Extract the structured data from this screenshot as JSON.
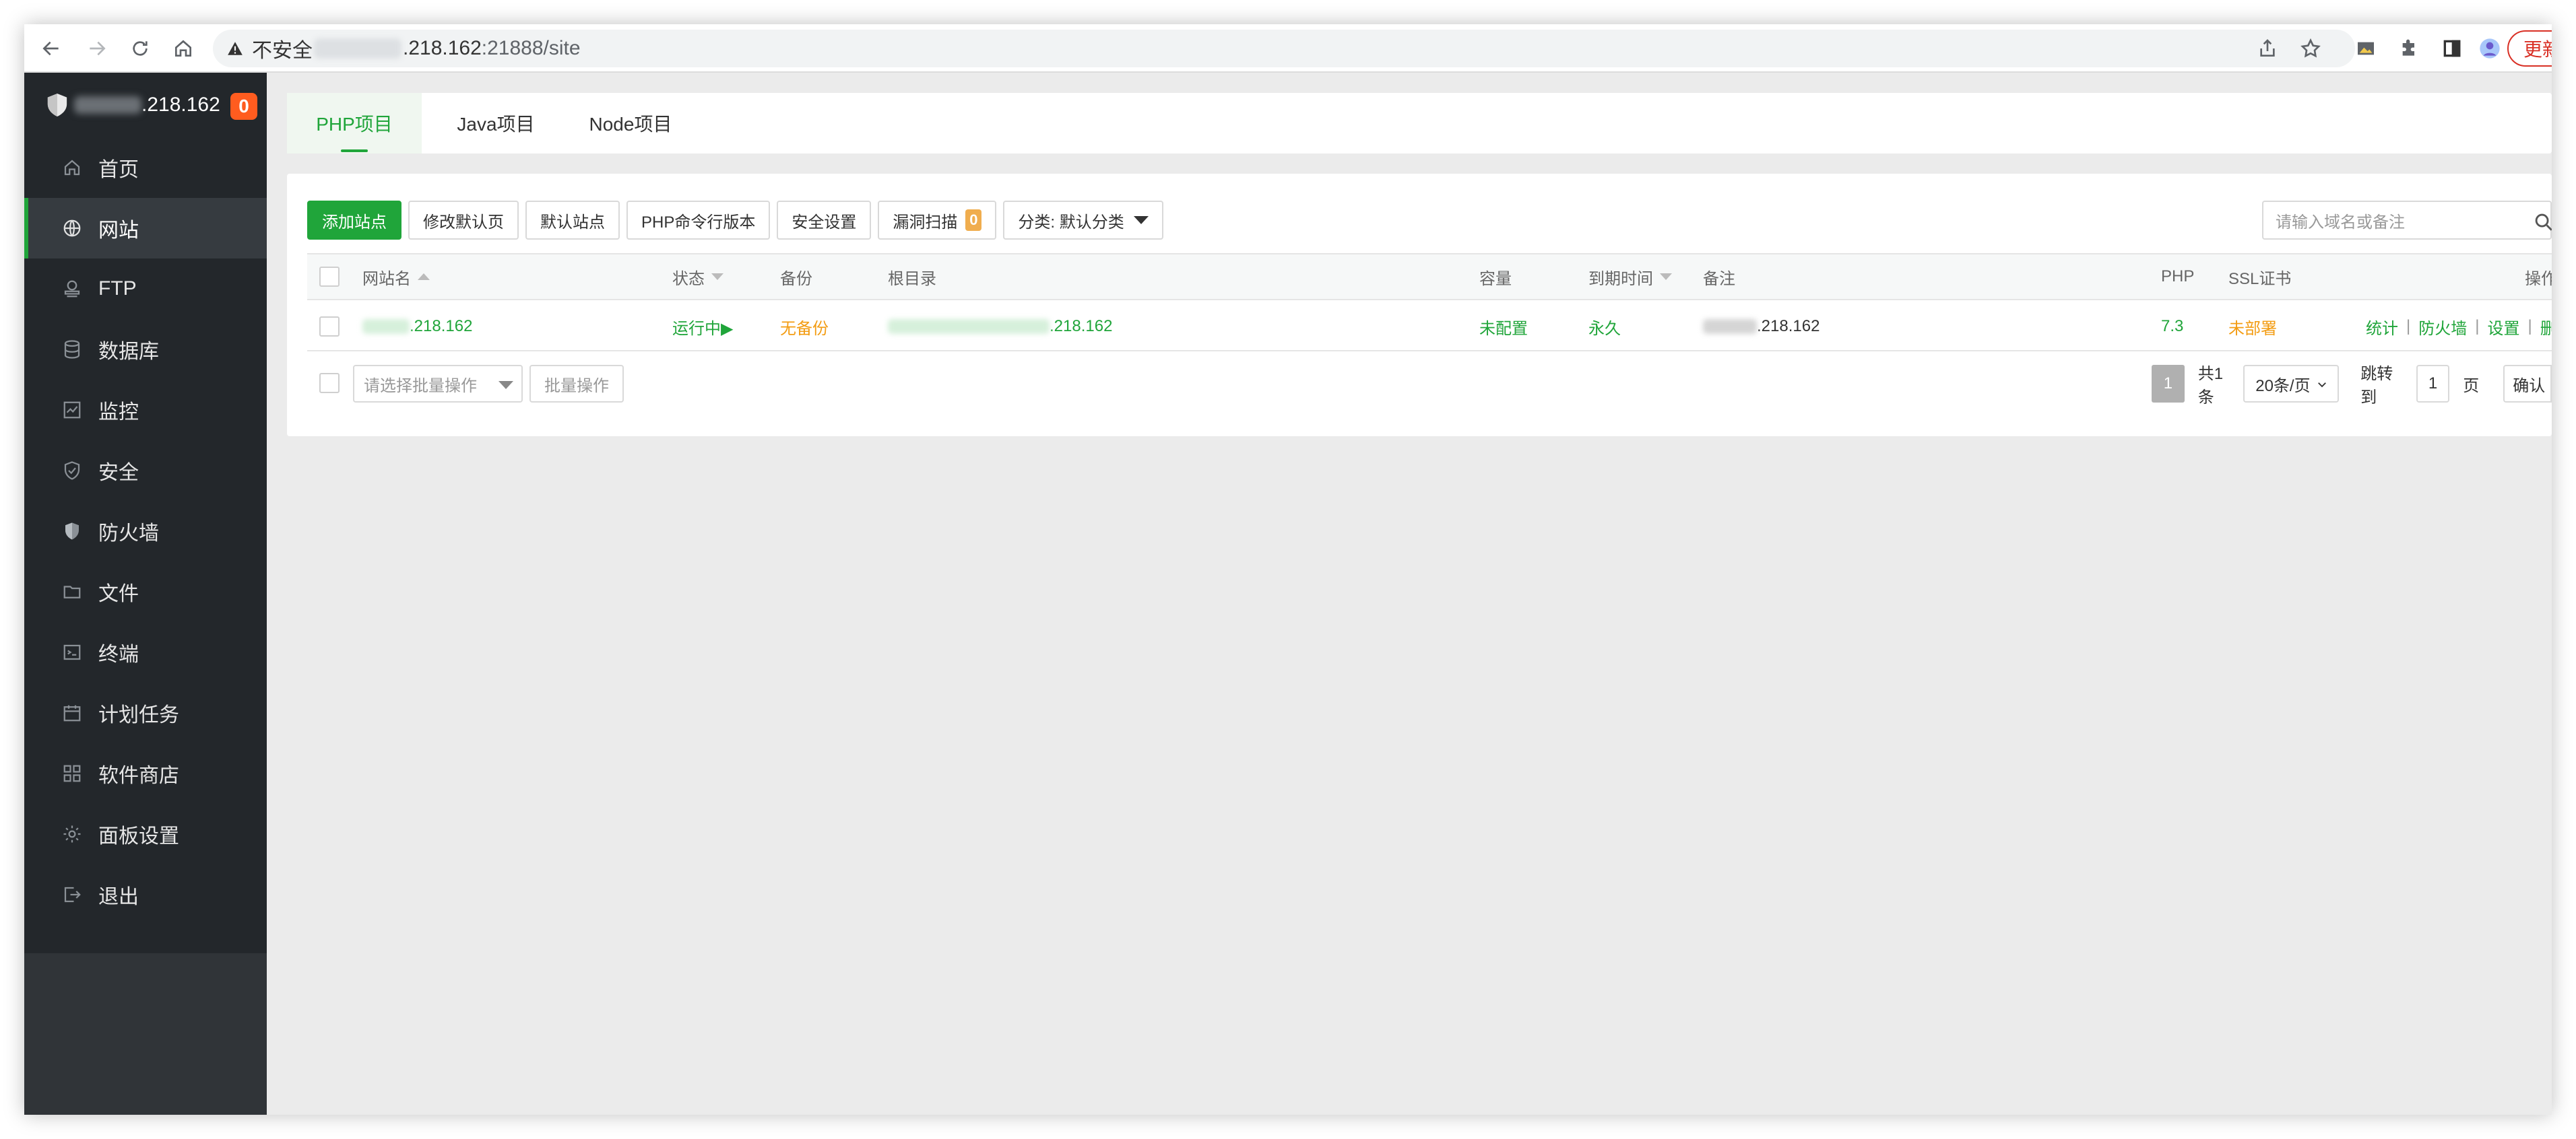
{
  "browser": {
    "security_label": "不安全",
    "url_host_suffix": ".218.162",
    "url_port_path": ":21888/site",
    "update_label": "更新"
  },
  "sidebar": {
    "brand_suffix": ".218.162",
    "brand_badge": "0",
    "items": [
      {
        "label": "首页",
        "icon": "home-icon"
      },
      {
        "label": "网站",
        "icon": "globe-icon",
        "active": true
      },
      {
        "label": "FTP",
        "icon": "ftp-icon"
      },
      {
        "label": "数据库",
        "icon": "database-icon"
      },
      {
        "label": "监控",
        "icon": "monitor-icon"
      },
      {
        "label": "安全",
        "icon": "shield-check-icon"
      },
      {
        "label": "防火墙",
        "icon": "firewall-shield-icon"
      },
      {
        "label": "文件",
        "icon": "folder-icon"
      },
      {
        "label": "终端",
        "icon": "terminal-icon"
      },
      {
        "label": "计划任务",
        "icon": "calendar-icon"
      },
      {
        "label": "软件商店",
        "icon": "apps-grid-icon"
      },
      {
        "label": "面板设置",
        "icon": "gear-icon"
      },
      {
        "label": "退出",
        "icon": "logout-icon"
      }
    ]
  },
  "tabs": [
    "PHP项目",
    "Java项目",
    "Node项目"
  ],
  "toolbar": {
    "add_site": "添加站点",
    "edit_default_page": "修改默认页",
    "default_site": "默认站点",
    "php_cli_version": "PHP命令行版本",
    "security_settings": "安全设置",
    "vuln_scan": "漏洞扫描",
    "vuln_scan_badge": "0",
    "category": "分类: 默认分类",
    "search_placeholder": "请输入域名或备注"
  },
  "table": {
    "headers": {
      "site_name": "网站名",
      "status": "状态",
      "backup": "备份",
      "root_dir": "根目录",
      "capacity": "容量",
      "expiry": "到期时间",
      "remark": "备注",
      "php": "PHP",
      "ssl": "SSL证书",
      "actions": "操作"
    },
    "rows": [
      {
        "site_name_suffix": ".218.162",
        "status": "运行中▶",
        "backup": "无备份",
        "root_dir_suffix": ".218.162",
        "capacity": "未配置",
        "expiry": "永久",
        "remark_suffix": ".218.162",
        "php": "7.3",
        "ssl": "未部署",
        "actions": [
          "统计",
          "防火墙",
          "设置",
          "删除"
        ]
      }
    ]
  },
  "footer": {
    "batch_placeholder": "请选择批量操作",
    "batch_button": "批量操作",
    "current_page": "1",
    "total": "共1条",
    "per_page": "20条/页",
    "jump_label": "跳转到",
    "jump_value": "1",
    "page_unit": "页",
    "confirm": "确认"
  },
  "colors": {
    "accent_green": "#20a53a",
    "sidebar_bg": "#23272b",
    "warning_orange": "#f39c12",
    "badge_red": "#ff5c1f"
  }
}
